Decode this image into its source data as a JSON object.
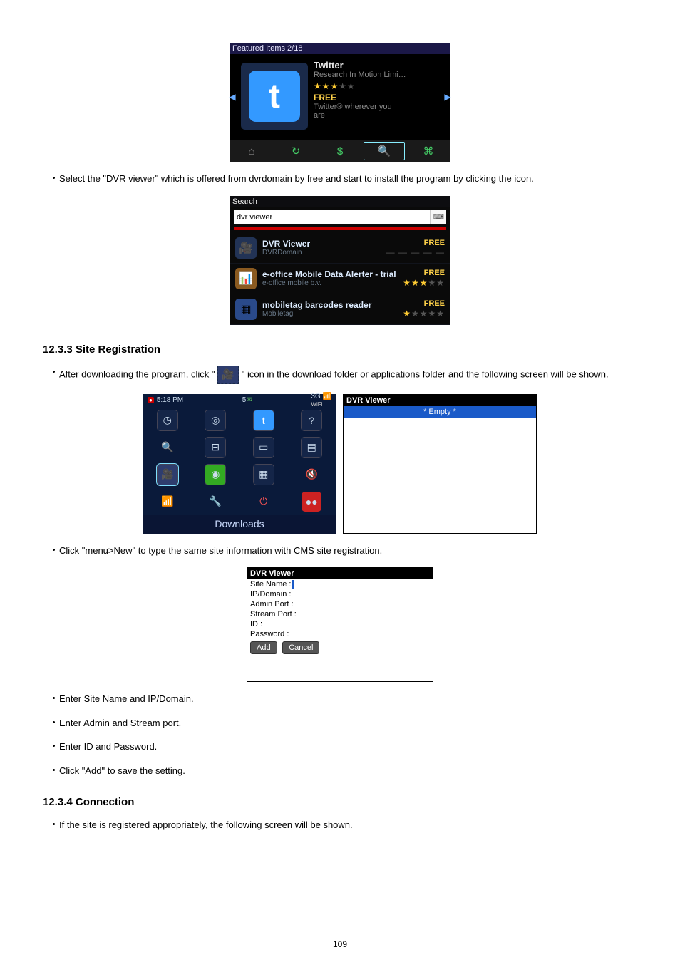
{
  "featured": {
    "header": "Featured Items 2/18",
    "item": {
      "title": "Twitter",
      "publisher": "Research In Motion Limi…",
      "stars": 3,
      "price": "FREE",
      "desc_line1": "Twitter® wherever you",
      "desc_line2": "are"
    },
    "bottom_icons": [
      "home-icon",
      "reload-icon",
      "dollar-icon",
      "search-icon",
      "apps-icon"
    ]
  },
  "bullet_select": "Select the \"DVR viewer\" which is offered from dvrdomain by free and start to install the program by clicking the icon.",
  "search": {
    "title": "Search",
    "query": "dvr viewer",
    "items": [
      {
        "name": "DVR Viewer",
        "publisher": "DVRDomain",
        "price": "FREE",
        "stars": 0,
        "icon": "dvr-icon"
      },
      {
        "name": "e-office Mobile Data Alerter - trial",
        "publisher": "e-office mobile b.v.",
        "price": "FREE",
        "stars": 3,
        "icon": "eoffice-icon"
      },
      {
        "name": "mobiletag barcodes reader",
        "publisher": "Mobiletag",
        "price": "FREE",
        "stars": 1,
        "icon": "barcode-icon"
      }
    ]
  },
  "section_registration": "12.3.3  Site Registration",
  "bullet_download_a": "After downloading the program, click \"",
  "bullet_download_b": "\" icon in the download folder or applications folder and the following screen will be shown.",
  "downloads": {
    "time": "5:18 PM",
    "notif": "5",
    "signal": "3G",
    "label": "Downloads"
  },
  "dvr_empty": {
    "header": "DVR Viewer",
    "empty": "* Empty *"
  },
  "bullet_menu_new": "Click \"menu>New\" to type the same site information with CMS site registration.",
  "dvrform": {
    "header": "DVR Viewer",
    "fields": {
      "site_name": "Site Name :",
      "ip_domain": "IP/Domain :",
      "admin_port": "Admin Port :",
      "stream_port": "Stream Port :",
      "id": "ID :",
      "password": "Password :"
    },
    "buttons": {
      "add": "Add",
      "cancel": "Cancel"
    }
  },
  "bullets2": [
    "Enter Site Name and IP/Domain.",
    "Enter Admin and Stream port.",
    "Enter ID and Password.",
    "Click \"Add\" to save the setting."
  ],
  "section_connection": "12.3.4  Connection",
  "bullet_connection": "If the site is registered appropriately, the following screen will be shown.",
  "page_number": "109"
}
